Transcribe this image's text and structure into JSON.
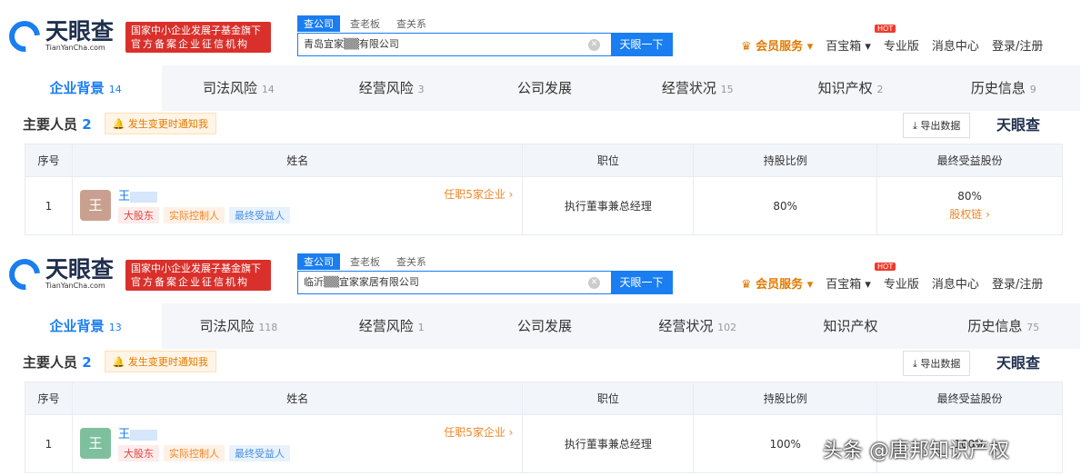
{
  "logo": {
    "cn": "天眼查",
    "en": "TianYanCha.com"
  },
  "badge": {
    "line1": "国家中小企业发展子基金旗下",
    "line2": "官方备案企业征信机构"
  },
  "search_tabs": [
    "查公司",
    "查老板",
    "查关系"
  ],
  "search_button": "天眼一下",
  "nav": {
    "vip": "♛ 会员服务 ▾",
    "baibao": "百宝箱 ▾",
    "hot": "HOT",
    "pro": "专业版",
    "msg": "消息中心",
    "login": "登录/注册"
  },
  "section": {
    "title": "主要人员",
    "notify": "🔔 发生变更时通知我",
    "export": "⤓ 导出数据",
    "brand": "天眼查"
  },
  "columns": [
    "序号",
    "姓名",
    "职位",
    "持股比例",
    "最终受益股份"
  ],
  "tags": [
    "大股东",
    "实际控制人",
    "最终受益人"
  ],
  "colors": {
    "accent": "#1a7ef0",
    "avatar1": "#c9a08f",
    "avatar2": "#7ec09e"
  },
  "panels": [
    {
      "query": "青岛宜家▒▒有限公司",
      "tabs": [
        {
          "l": "企业背景",
          "c": "14"
        },
        {
          "l": "司法风险",
          "c": "14"
        },
        {
          "l": "经营风险",
          "c": "3"
        },
        {
          "l": "公司发展",
          "c": ""
        },
        {
          "l": "经营状况",
          "c": "15"
        },
        {
          "l": "知识产权",
          "c": "2"
        },
        {
          "l": "历史信息",
          "c": "9"
        }
      ],
      "count": "2",
      "row": {
        "no": "1",
        "avatar": "王",
        "name": "王",
        "jobs": "任职5家企业 ›",
        "position": "执行董事兼总经理",
        "share": "80%",
        "final": "80%",
        "chain": "股权链 ›"
      }
    },
    {
      "query": "临沂▒▒宜家家居有限公司",
      "tabs": [
        {
          "l": "企业背景",
          "c": "13"
        },
        {
          "l": "司法风险",
          "c": "118"
        },
        {
          "l": "经营风险",
          "c": "1"
        },
        {
          "l": "公司发展",
          "c": ""
        },
        {
          "l": "经营状况",
          "c": "102"
        },
        {
          "l": "知识产权",
          "c": ""
        },
        {
          "l": "历史信息",
          "c": "75"
        }
      ],
      "count": "2",
      "row": {
        "no": "1",
        "avatar": "王",
        "name": "王",
        "jobs": "任职5家企业 ›",
        "position": "执行董事兼总经理",
        "share": "100%",
        "final": "100%"
      }
    }
  ],
  "watermark": "头条 @唐邦知识产权"
}
